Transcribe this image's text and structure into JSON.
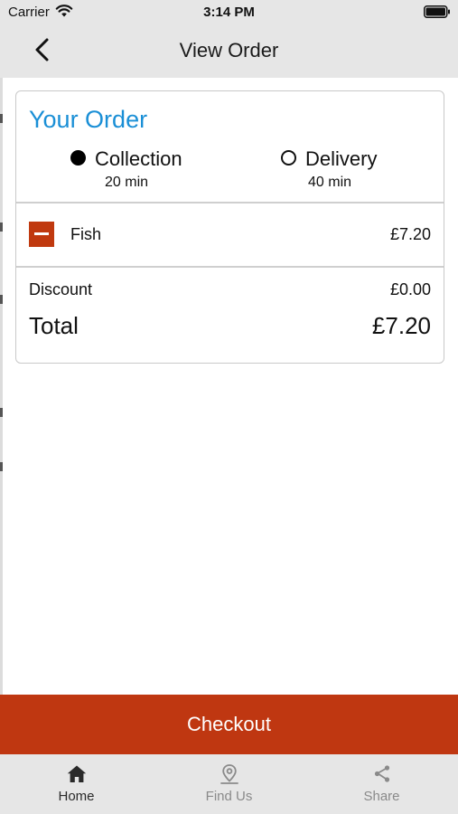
{
  "status_bar": {
    "carrier": "Carrier",
    "time": "3:14 PM"
  },
  "nav": {
    "title": "View Order",
    "back_icon": "chevron-left-icon"
  },
  "order": {
    "title": "Your Order",
    "options": [
      {
        "label": "Collection",
        "time": "20 min",
        "selected": true
      },
      {
        "label": "Delivery",
        "time": "40 min",
        "selected": false
      }
    ],
    "items": [
      {
        "name": "Fish",
        "price": "£7.20"
      }
    ],
    "discount_label": "Discount",
    "discount_value": "£0.00",
    "total_label": "Total",
    "total_value": "£7.20"
  },
  "checkout_label": "Checkout",
  "tabs": [
    {
      "label": "Home",
      "icon": "home-icon",
      "active": true
    },
    {
      "label": "Find Us",
      "icon": "location-pin-icon",
      "active": false
    },
    {
      "label": "Share",
      "icon": "share-icon",
      "active": false
    }
  ],
  "colors": {
    "accent": "#1a8fd6",
    "checkout": "#bf3711",
    "remove": "#c0390f",
    "bar_background": "#e6e6e6"
  }
}
